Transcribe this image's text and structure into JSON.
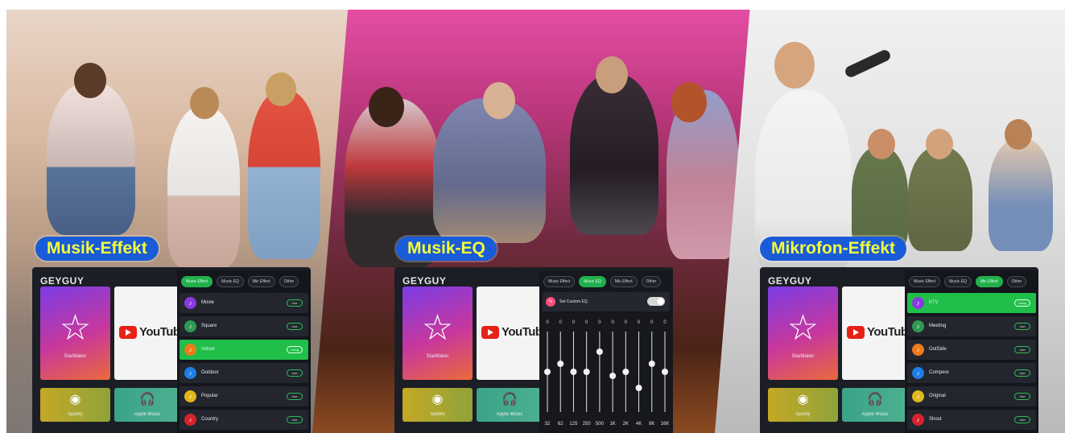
{
  "panels": [
    {
      "label": "Musik-Effekt",
      "brand": "GEYGUY",
      "apps": {
        "starmaker": "StarMaker",
        "youtube": "YouTube",
        "spotify": "Spotify",
        "apple_music": "Apple Music"
      },
      "tabs": [
        {
          "label": "Music Effect",
          "active": true
        },
        {
          "label": "Music EQ",
          "active": false
        },
        {
          "label": "Mic Effect",
          "active": false
        },
        {
          "label": "Other",
          "active": false
        }
      ],
      "items": [
        {
          "name": "Movie",
          "button": "Use",
          "color": "#8a3ae0",
          "selected": false
        },
        {
          "name": "Square",
          "button": "Use",
          "color": "#2f9a55",
          "selected": false
        },
        {
          "name": "Indoor",
          "button": "Using",
          "color": "#f07a1a",
          "selected": true
        },
        {
          "name": "Outdoor",
          "button": "Use",
          "color": "#1e7ee6",
          "selected": false
        },
        {
          "name": "Popular",
          "button": "Use",
          "color": "#e0b81c",
          "selected": false
        },
        {
          "name": "Country",
          "button": "Use",
          "color": "#d6232c",
          "selected": false
        }
      ]
    },
    {
      "label": "Musik-EQ",
      "brand": "GEYGUY",
      "apps": {
        "starmaker": "StarMaker",
        "youtube": "YouTube",
        "spotify": "Spotify",
        "apple_music": "Apple Music"
      },
      "tabs": [
        {
          "label": "Music Effect",
          "active": false
        },
        {
          "label": "Music EQ",
          "active": true
        },
        {
          "label": "Mic Effect",
          "active": false
        },
        {
          "label": "Other",
          "active": false
        }
      ],
      "custom_eq_label": "Set Custom EQ",
      "custom_eq_enabled": true,
      "eq": {
        "bands": [
          "32",
          "62",
          "125",
          "250",
          "500",
          "1K",
          "2K",
          "4K",
          "8K",
          "16K"
        ],
        "values_display": [
          "0",
          "0",
          "0",
          "0",
          "0",
          "0",
          "0",
          "0",
          "0",
          "0"
        ],
        "levels": [
          0.5,
          0.6,
          0.5,
          0.5,
          0.75,
          0.45,
          0.5,
          0.3,
          0.6,
          0.5
        ]
      }
    },
    {
      "label": "Mikrofon-Effekt",
      "brand": "GEYGUY",
      "apps": {
        "starmaker": "StarMaker",
        "youtube": "YouTube",
        "spotify": "Spotify",
        "apple_music": "Apple Music"
      },
      "tabs": [
        {
          "label": "Music Effect",
          "active": false
        },
        {
          "label": "Music EQ",
          "active": false
        },
        {
          "label": "Mic Effect",
          "active": true
        },
        {
          "label": "Other",
          "active": false
        }
      ],
      "items": [
        {
          "name": "KTV",
          "button": "Using",
          "color": "#8a3ae0",
          "selected": true
        },
        {
          "name": "Meeting",
          "button": "Use",
          "color": "#2f9a55",
          "selected": false
        },
        {
          "name": "OutSide",
          "button": "Use",
          "color": "#f07a1a",
          "selected": false
        },
        {
          "name": "Compere",
          "button": "Use",
          "color": "#1e7ee6",
          "selected": false
        },
        {
          "name": "Original",
          "button": "Use",
          "color": "#e0b81c",
          "selected": false
        },
        {
          "name": "Shout",
          "button": "Use",
          "color": "#d6232c",
          "selected": false
        }
      ]
    }
  ]
}
